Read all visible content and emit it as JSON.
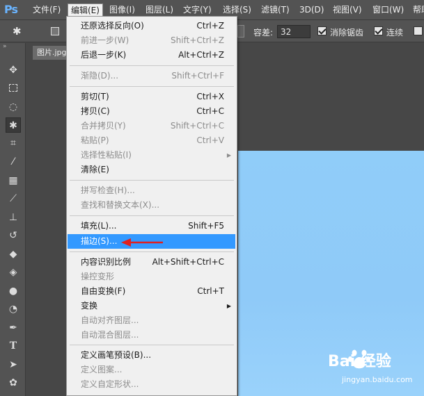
{
  "app": {
    "logo": "Ps"
  },
  "menubar": {
    "items": [
      "文件(F)",
      "编辑(E)",
      "图像(I)",
      "图层(L)",
      "文字(Y)",
      "选择(S)",
      "滤镜(T)",
      "3D(D)",
      "视图(V)",
      "窗口(W)",
      "帮助(H)"
    ],
    "active_index": 1
  },
  "options": {
    "tolerance_label": "容差:",
    "tolerance_value": "32",
    "antialias_label": "消除锯齿",
    "contiguous_label": "连续"
  },
  "document": {
    "tab_label": "图片.jpg"
  },
  "edit_menu": {
    "groups": [
      [
        {
          "label": "还原选择反向(O)",
          "shortcut": "Ctrl+Z",
          "enabled": true
        },
        {
          "label": "前进一步(W)",
          "shortcut": "Shift+Ctrl+Z",
          "enabled": false
        },
        {
          "label": "后退一步(K)",
          "shortcut": "Alt+Ctrl+Z",
          "enabled": true
        }
      ],
      [
        {
          "label": "渐隐(D)...",
          "shortcut": "Shift+Ctrl+F",
          "enabled": false
        }
      ],
      [
        {
          "label": "剪切(T)",
          "shortcut": "Ctrl+X",
          "enabled": true
        },
        {
          "label": "拷贝(C)",
          "shortcut": "Ctrl+C",
          "enabled": true
        },
        {
          "label": "合并拷贝(Y)",
          "shortcut": "Shift+Ctrl+C",
          "enabled": false
        },
        {
          "label": "粘贴(P)",
          "shortcut": "Ctrl+V",
          "enabled": false
        },
        {
          "label": "选择性粘贴(I)",
          "shortcut": "",
          "enabled": false,
          "submenu": true
        },
        {
          "label": "清除(E)",
          "shortcut": "",
          "enabled": true
        }
      ],
      [
        {
          "label": "拼写检查(H)...",
          "shortcut": "",
          "enabled": false
        },
        {
          "label": "查找和替换文本(X)...",
          "shortcut": "",
          "enabled": false
        }
      ],
      [
        {
          "label": "填充(L)...",
          "shortcut": "Shift+F5",
          "enabled": true
        },
        {
          "label": "描边(S)...",
          "shortcut": "",
          "enabled": true,
          "highlighted": true
        }
      ],
      [
        {
          "label": "内容识别比例",
          "shortcut": "Alt+Shift+Ctrl+C",
          "enabled": true
        },
        {
          "label": "操控变形",
          "shortcut": "",
          "enabled": false
        },
        {
          "label": "自由变换(F)",
          "shortcut": "Ctrl+T",
          "enabled": true
        },
        {
          "label": "变换",
          "shortcut": "",
          "enabled": true,
          "submenu": true
        },
        {
          "label": "自动对齐图层...",
          "shortcut": "",
          "enabled": false
        },
        {
          "label": "自动混合图层...",
          "shortcut": "",
          "enabled": false
        }
      ],
      [
        {
          "label": "定义画笔预设(B)...",
          "shortcut": "",
          "enabled": true
        },
        {
          "label": "定义图案...",
          "shortcut": "",
          "enabled": false
        },
        {
          "label": "定义自定形状...",
          "shortcut": "",
          "enabled": false
        }
      ]
    ]
  },
  "tools": [
    "move-tool-icon",
    "marquee-tool-icon",
    "lasso-tool-icon",
    "magic-wand-tool-icon",
    "crop-tool-icon",
    "eyedropper-tool-icon",
    "healing-brush-tool-icon",
    "brush-tool-icon",
    "clone-stamp-tool-icon",
    "history-brush-tool-icon",
    "eraser-tool-icon",
    "paint-bucket-tool-icon",
    "blur-tool-icon",
    "dodge-tool-icon",
    "pen-tool-icon",
    "type-tool-icon",
    "path-selection-tool-icon",
    "shape-tool-icon"
  ],
  "active_tool_index": 3,
  "watermark": {
    "brand": "Bai 经验",
    "url": "jingyan.baidu.com"
  },
  "colors": {
    "highlight": "#3399ff",
    "canvas": "#90cdf9",
    "arrow": "#e02020",
    "logo": "#6ab4ff"
  }
}
